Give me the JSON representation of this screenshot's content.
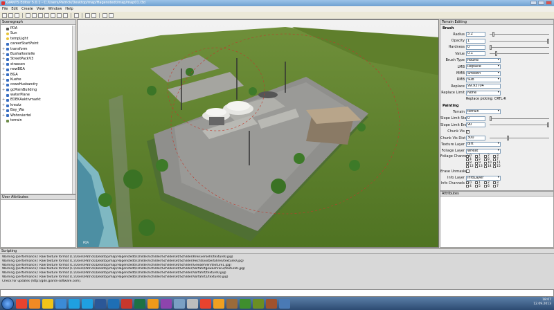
{
  "window": {
    "title": "GIANTS Editor 5.0.1 - C:/Users/Patrick/Desktop/map/Hagenstedt/map/map01.i3d"
  },
  "menu": [
    "File",
    "Edit",
    "Create",
    "View",
    "Window",
    "Help"
  ],
  "scenegraph": {
    "title": "Scenegraph",
    "items": [
      {
        "label": "PDA",
        "icon": "camera-icon",
        "expand": ""
      },
      {
        "label": "Sun",
        "icon": "light-icon",
        "expand": ""
      },
      {
        "label": "tempLight",
        "icon": "light-icon",
        "expand": ""
      },
      {
        "label": "careerStartPoint",
        "icon": "transform-icon",
        "expand": ""
      },
      {
        "label": "transform",
        "icon": "transform-icon",
        "expand": "+"
      },
      {
        "label": "Bushaltestelle",
        "icon": "transform-icon",
        "expand": "+"
      },
      {
        "label": "StreetPackV3",
        "icon": "transform-icon",
        "expand": "+"
      },
      {
        "label": "strassen",
        "icon": "transform-icon",
        "expand": "+"
      },
      {
        "label": "newBGA",
        "icon": "transform-icon",
        "expand": "+"
      },
      {
        "label": "BGA",
        "icon": "transform-icon",
        "expand": "+"
      },
      {
        "label": "Kuehe",
        "icon": "transform-icon",
        "expand": "+"
      },
      {
        "label": "cowsHusbandry",
        "icon": "transform-icon",
        "expand": "+"
      },
      {
        "label": "gcMainBuilding",
        "icon": "transform-icon",
        "expand": "+"
      },
      {
        "label": "waterPlane",
        "icon": "transform-icon",
        "expand": ""
      },
      {
        "label": "EDEKAaktivmarkt",
        "icon": "transform-icon",
        "expand": "+"
      },
      {
        "label": "kreutz",
        "icon": "transform-icon",
        "expand": "+"
      },
      {
        "label": "Bay_Wa",
        "icon": "transform-icon",
        "expand": "+"
      },
      {
        "label": "Wohnviertel",
        "icon": "transform-icon",
        "expand": "+"
      },
      {
        "label": "terrain",
        "icon": "terrain-icon",
        "expand": ""
      }
    ]
  },
  "user_attributes": {
    "title": "User Attributes"
  },
  "viewport": {
    "label": "PDA"
  },
  "terrain_editing": {
    "title": "Terrain Editing",
    "brush_section": "Brush",
    "radius": {
      "label": "Radius",
      "value": "5.2",
      "level": 0.05
    },
    "opacity": {
      "label": "Opacity",
      "value": "1",
      "level": 1.0
    },
    "hardness": {
      "label": "Hardness",
      "value": "0",
      "level": 0.0
    },
    "value": {
      "label": "Value",
      "value": "0.1",
      "level": 0.1
    },
    "brush_type": {
      "label": "Brush Type",
      "value": "Round"
    },
    "lmb": {
      "label": "LMB",
      "value": "Replace"
    },
    "mmb": {
      "label": "MMB",
      "value": "Smooth"
    },
    "rmb": {
      "label": "RMB",
      "value": "Sub"
    },
    "replace": {
      "label": "Replace",
      "value": "99.93704"
    },
    "replace_limit": {
      "label": "Replace Limit",
      "value": "None"
    },
    "replace_picking": "Replace picking: CRTL-R",
    "painting_section": "Painting",
    "terrain": {
      "label": "Terrain",
      "value": "terrain"
    },
    "slope_start": {
      "label": "Slope Limit Start",
      "value": "0",
      "level": 0.0
    },
    "slope_end": {
      "label": "Slope Limit End",
      "value": "90",
      "level": 1.0
    },
    "chunk_vis": {
      "label": "Chunk Vis",
      "checked": true
    },
    "chunk_vis_dist": {
      "label": "Chunk Vis Dist",
      "value": "300",
      "level": 0.3
    },
    "texture_layer": {
      "label": "Texture Layer",
      "value": "dirt"
    },
    "foliage_layer": {
      "label": "Foliage Layer",
      "value": "wheat"
    },
    "foliage_channels": {
      "label": "Foliage Channels",
      "values": [
        "0",
        "1",
        "2",
        "3",
        "4",
        "5",
        "6",
        "7",
        "8",
        "9",
        "10",
        "11",
        "12",
        "13",
        "14",
        "15"
      ]
    },
    "erase_unmasked": {
      "label": "Erase Unmasked",
      "checked": false
    },
    "info_layer": {
      "label": "Info Layer",
      "value": "infoLayer"
    },
    "info_channels": {
      "label": "Info Channels",
      "values": [
        "0",
        "1",
        "2",
        "3",
        "4",
        "5",
        "6",
        "7"
      ]
    }
  },
  "attributes": {
    "title": "Attributes"
  },
  "scripting": {
    "title": "Scripting",
    "lines": [
      "Warning (performance): Raw texture format (C:/Users/Patrick/Desktop/map/Hagenstedt/schilder/schilder/Schilderset/Schilder/Kreisverkehr/texture0.jpg)",
      "Warning (performance): Raw texture format (C:/Users/Patrick/Desktop/map/Hagenstedt/schilder/schilder/Schilderset/Schilder/Rechtsvorbeifahren/texture0.jpg)",
      "Warning (performance): Raw texture format (C:/Users/Patrick/Desktop/map/Hagenstedt/schilder/schilder/Schilderset/Schilder/Gewaehren/texture1.jpg)",
      "Warning (performance): Raw texture format (C:/Users/Patrick/Desktop/map/Hagenstedt/schilder/schilder/Schilderset/Schilder/Vorfahrtgewaehren2/texture0.jpg)",
      "Warning (performance): Raw texture format (C:/Users/Patrick/Desktop/map/Hagenstedt/schilder/schilder/Schilderset/Schilder/Vorfahrt/texture0.jpg)",
      "Warning (performance): Raw texture format (C:/Users/Patrick/Desktop/map/Hagenstedt/schilder/schilder/Schilderset/Schilder/Vorfahrt2/texture0.jpg)",
      "Check for updates (http://gdn.giants-software.com)."
    ]
  },
  "taskbar": {
    "apps": [
      "chrome",
      "firefox",
      "explorer",
      "media",
      "skype",
      "skype2",
      "word",
      "photoshop",
      "giants",
      "excel",
      "vlc",
      "winrar",
      "notepad",
      "settings",
      "chrome2",
      "winamp",
      "game",
      "tractor",
      "farming",
      "game2",
      "mail"
    ],
    "time": "18:07",
    "date": "12.09.2013"
  },
  "colors": {
    "grass": "#5a7f2a",
    "sky": "#e8e8e8",
    "concrete": "#8c8c8a",
    "taskbar": "#2d4b72"
  }
}
